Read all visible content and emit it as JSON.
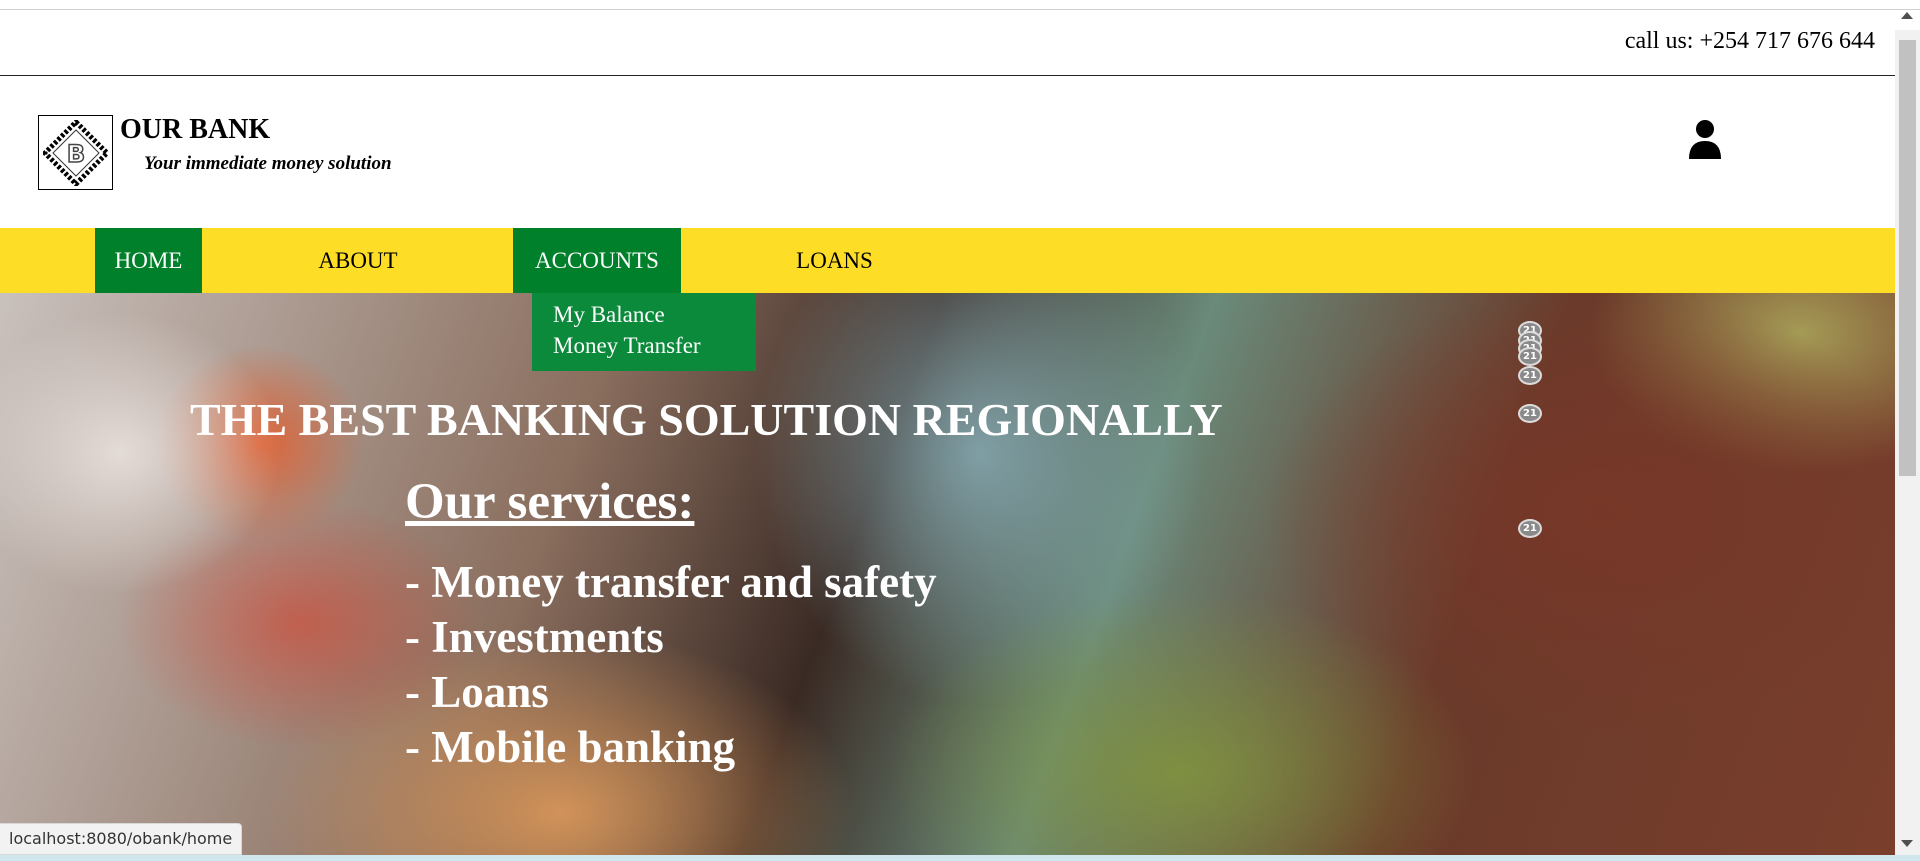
{
  "topbar": {
    "phone": "call us: +254 717 676 644"
  },
  "brand": {
    "name": "OUR BANK",
    "tagline": "Your immediate money solution",
    "logo_letter": "B"
  },
  "nav": {
    "items": [
      {
        "label": "HOME",
        "active": true
      },
      {
        "label": "ABOUT",
        "active": false
      },
      {
        "label": "ACCOUNTS",
        "active": true
      },
      {
        "label": "LOANS",
        "active": false
      }
    ],
    "dropdown": [
      "My Balance",
      "Money Transfer"
    ]
  },
  "hero": {
    "headline": "THE BEST BANKING SOLUTION REGIONALLY",
    "services_title": "Our services:",
    "services": [
      "- Money transfer and safety",
      "- Investments",
      "- Loans",
      "- Mobile banking"
    ],
    "coin_label": "21"
  },
  "status_bar": {
    "url": "localhost:8080/obank/home"
  },
  "colors": {
    "nav_bg": "#fddd25",
    "nav_active": "#00802b",
    "dropdown_bg": "#0a8a3a"
  },
  "icons": [
    "logo-icon",
    "user-icon",
    "coin-icon"
  ]
}
